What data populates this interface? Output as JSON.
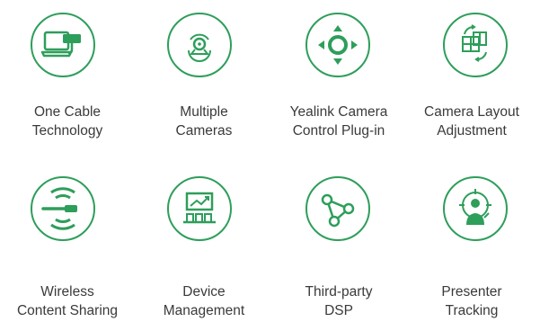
{
  "colors": {
    "accent": "#2e9e5b",
    "text": "#3a3a3a"
  },
  "features": [
    {
      "icon": "laptop-cable-icon",
      "line1": "One Cable",
      "line2": "Technology"
    },
    {
      "icon": "multiple-cameras-icon",
      "line1": "Multiple",
      "line2": "Cameras"
    },
    {
      "icon": "camera-control-dpad-icon",
      "line1": "Yealink Camera",
      "line2": "Control Plug-in"
    },
    {
      "icon": "camera-layout-icon",
      "line1": "Camera Layout",
      "line2": "Adjustment"
    },
    {
      "icon": "wireless-share-icon",
      "line1": "Wireless",
      "line2": "Content Sharing"
    },
    {
      "icon": "device-management-icon",
      "line1": "Device",
      "line2": "Management"
    },
    {
      "icon": "third-party-dsp-icon",
      "line1": "Third-party",
      "line2": "DSP"
    },
    {
      "icon": "presenter-tracking-icon",
      "line1": "Presenter",
      "line2": "Tracking"
    }
  ]
}
